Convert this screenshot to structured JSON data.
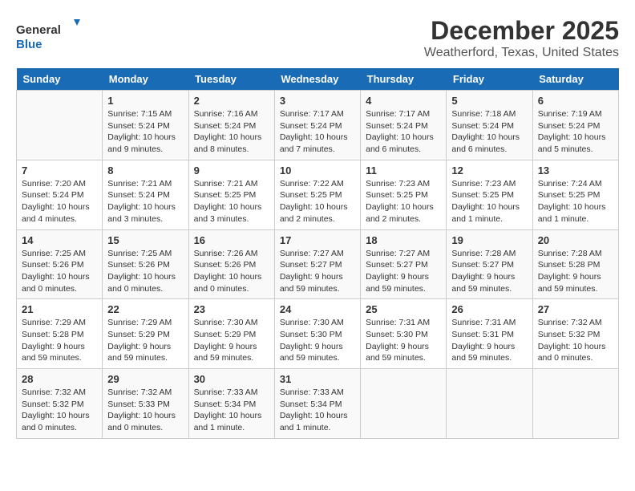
{
  "header": {
    "logo_line1": "General",
    "logo_line2": "Blue",
    "title": "December 2025",
    "subtitle": "Weatherford, Texas, United States"
  },
  "days_of_week": [
    "Sunday",
    "Monday",
    "Tuesday",
    "Wednesday",
    "Thursday",
    "Friday",
    "Saturday"
  ],
  "weeks": [
    [
      {
        "day": "",
        "info": ""
      },
      {
        "day": "1",
        "info": "Sunrise: 7:15 AM\nSunset: 5:24 PM\nDaylight: 10 hours\nand 9 minutes."
      },
      {
        "day": "2",
        "info": "Sunrise: 7:16 AM\nSunset: 5:24 PM\nDaylight: 10 hours\nand 8 minutes."
      },
      {
        "day": "3",
        "info": "Sunrise: 7:17 AM\nSunset: 5:24 PM\nDaylight: 10 hours\nand 7 minutes."
      },
      {
        "day": "4",
        "info": "Sunrise: 7:17 AM\nSunset: 5:24 PM\nDaylight: 10 hours\nand 6 minutes."
      },
      {
        "day": "5",
        "info": "Sunrise: 7:18 AM\nSunset: 5:24 PM\nDaylight: 10 hours\nand 6 minutes."
      },
      {
        "day": "6",
        "info": "Sunrise: 7:19 AM\nSunset: 5:24 PM\nDaylight: 10 hours\nand 5 minutes."
      }
    ],
    [
      {
        "day": "7",
        "info": "Sunrise: 7:20 AM\nSunset: 5:24 PM\nDaylight: 10 hours\nand 4 minutes."
      },
      {
        "day": "8",
        "info": "Sunrise: 7:21 AM\nSunset: 5:24 PM\nDaylight: 10 hours\nand 3 minutes."
      },
      {
        "day": "9",
        "info": "Sunrise: 7:21 AM\nSunset: 5:25 PM\nDaylight: 10 hours\nand 3 minutes."
      },
      {
        "day": "10",
        "info": "Sunrise: 7:22 AM\nSunset: 5:25 PM\nDaylight: 10 hours\nand 2 minutes."
      },
      {
        "day": "11",
        "info": "Sunrise: 7:23 AM\nSunset: 5:25 PM\nDaylight: 10 hours\nand 2 minutes."
      },
      {
        "day": "12",
        "info": "Sunrise: 7:23 AM\nSunset: 5:25 PM\nDaylight: 10 hours\nand 1 minute."
      },
      {
        "day": "13",
        "info": "Sunrise: 7:24 AM\nSunset: 5:25 PM\nDaylight: 10 hours\nand 1 minute."
      }
    ],
    [
      {
        "day": "14",
        "info": "Sunrise: 7:25 AM\nSunset: 5:26 PM\nDaylight: 10 hours\nand 0 minutes."
      },
      {
        "day": "15",
        "info": "Sunrise: 7:25 AM\nSunset: 5:26 PM\nDaylight: 10 hours\nand 0 minutes."
      },
      {
        "day": "16",
        "info": "Sunrise: 7:26 AM\nSunset: 5:26 PM\nDaylight: 10 hours\nand 0 minutes."
      },
      {
        "day": "17",
        "info": "Sunrise: 7:27 AM\nSunset: 5:27 PM\nDaylight: 9 hours\nand 59 minutes."
      },
      {
        "day": "18",
        "info": "Sunrise: 7:27 AM\nSunset: 5:27 PM\nDaylight: 9 hours\nand 59 minutes."
      },
      {
        "day": "19",
        "info": "Sunrise: 7:28 AM\nSunset: 5:27 PM\nDaylight: 9 hours\nand 59 minutes."
      },
      {
        "day": "20",
        "info": "Sunrise: 7:28 AM\nSunset: 5:28 PM\nDaylight: 9 hours\nand 59 minutes."
      }
    ],
    [
      {
        "day": "21",
        "info": "Sunrise: 7:29 AM\nSunset: 5:28 PM\nDaylight: 9 hours\nand 59 minutes."
      },
      {
        "day": "22",
        "info": "Sunrise: 7:29 AM\nSunset: 5:29 PM\nDaylight: 9 hours\nand 59 minutes."
      },
      {
        "day": "23",
        "info": "Sunrise: 7:30 AM\nSunset: 5:29 PM\nDaylight: 9 hours\nand 59 minutes."
      },
      {
        "day": "24",
        "info": "Sunrise: 7:30 AM\nSunset: 5:30 PM\nDaylight: 9 hours\nand 59 minutes."
      },
      {
        "day": "25",
        "info": "Sunrise: 7:31 AM\nSunset: 5:30 PM\nDaylight: 9 hours\nand 59 minutes."
      },
      {
        "day": "26",
        "info": "Sunrise: 7:31 AM\nSunset: 5:31 PM\nDaylight: 9 hours\nand 59 minutes."
      },
      {
        "day": "27",
        "info": "Sunrise: 7:32 AM\nSunset: 5:32 PM\nDaylight: 10 hours\nand 0 minutes."
      }
    ],
    [
      {
        "day": "28",
        "info": "Sunrise: 7:32 AM\nSunset: 5:32 PM\nDaylight: 10 hours\nand 0 minutes."
      },
      {
        "day": "29",
        "info": "Sunrise: 7:32 AM\nSunset: 5:33 PM\nDaylight: 10 hours\nand 0 minutes."
      },
      {
        "day": "30",
        "info": "Sunrise: 7:33 AM\nSunset: 5:34 PM\nDaylight: 10 hours\nand 1 minute."
      },
      {
        "day": "31",
        "info": "Sunrise: 7:33 AM\nSunset: 5:34 PM\nDaylight: 10 hours\nand 1 minute."
      },
      {
        "day": "",
        "info": ""
      },
      {
        "day": "",
        "info": ""
      },
      {
        "day": "",
        "info": ""
      }
    ]
  ]
}
